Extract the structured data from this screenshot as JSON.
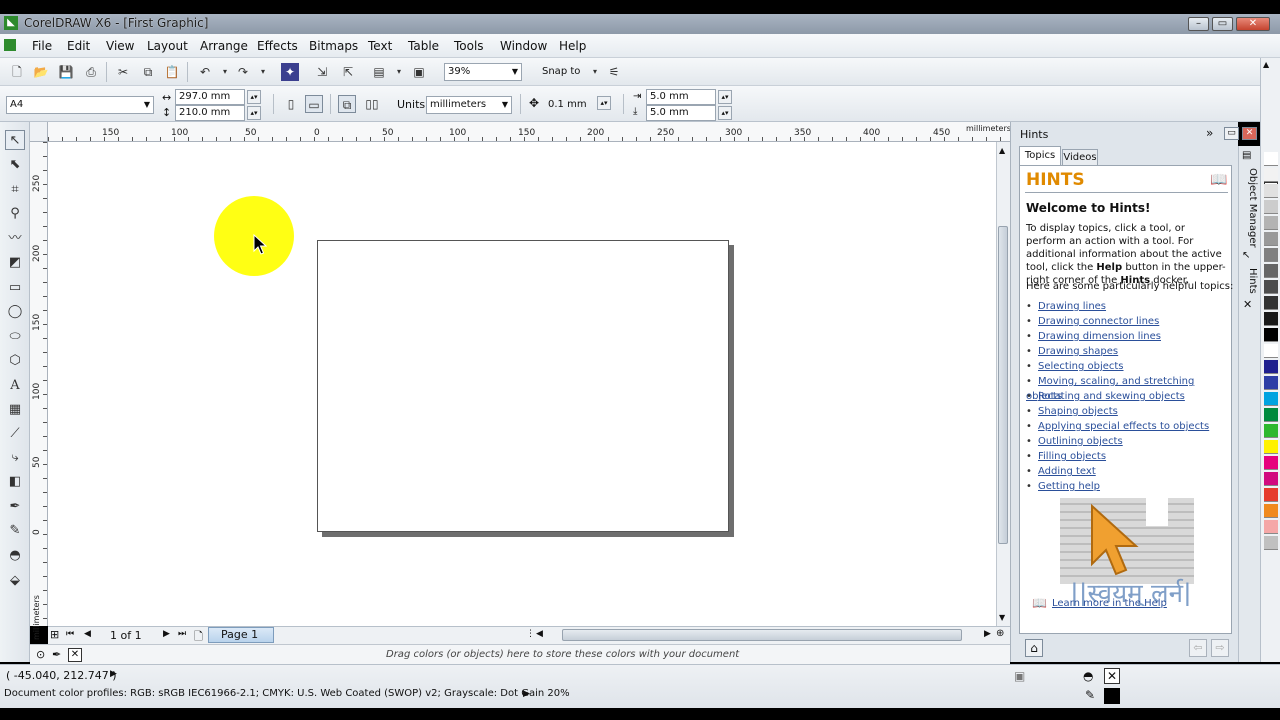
{
  "window": {
    "title": "CorelDRAW X6 - [First Graphic]",
    "controls": {
      "minimize": "–",
      "restore": "▭",
      "close": "✕"
    }
  },
  "menu": [
    "File",
    "Edit",
    "View",
    "Layout",
    "Arrange",
    "Effects",
    "Bitmaps",
    "Text",
    "Table",
    "Tools",
    "Window",
    "Help"
  ],
  "standard_toolbar": {
    "zoom_value": "39%",
    "snap_label": "Snap to"
  },
  "property_bar": {
    "paper_size": "A4",
    "width": "297.0 mm",
    "height": "210.0 mm",
    "units_label": "Units:",
    "units_value": "millimeters",
    "nudge": "0.1 mm",
    "dup_x": "5.0 mm",
    "dup_y": "5.0 mm"
  },
  "rulers": {
    "h_ticks": [
      "150",
      "100",
      "50",
      "0",
      "50",
      "100",
      "150",
      "200",
      "250",
      "300",
      "350",
      "400",
      "450"
    ],
    "h_unit": "millimeters",
    "v_ticks": [
      "250",
      "200",
      "150",
      "100",
      "50",
      "0"
    ],
    "v_unit": "millimeters"
  },
  "page_nav": {
    "counter": "1 of 1",
    "page_tab": "Page 1"
  },
  "document_palette": {
    "hint": "Drag colors (or objects) here to store these colors with your document"
  },
  "status": {
    "coords": "( -45.040, 212.747 )",
    "color_profiles": "Document color profiles: RGB: sRGB IEC61966-2.1; CMYK: U.S. Web Coated (SWOP) v2; Grayscale: Dot Gain 20%"
  },
  "hints_docker": {
    "title": "Hints",
    "tabs": [
      "Topics",
      "Videos"
    ],
    "heading": "HINTS",
    "welcome": "Welcome to Hints!",
    "intro_parts": [
      "To display topics, click a tool, or perform an action with a tool. For additional information about the active tool, click the ",
      "Help",
      " button in the upper-right corner of the ",
      "Hints",
      " docker."
    ],
    "topics_intro": "Here are some particularly helpful topics:",
    "topics": [
      "Drawing lines",
      "Drawing connector lines",
      "Drawing dimension lines",
      "Drawing shapes",
      "Selecting objects",
      "Moving, scaling, and stretching objects",
      "Rotating and skewing objects",
      "Shaping objects",
      "Applying special effects to objects",
      "Outlining objects",
      "Filling objects",
      "Adding text",
      "Getting help"
    ],
    "learn_more": "Learn more in the Help",
    "logo_text": "||स्वयम् लर्न||"
  },
  "side_tabs": [
    "Object Manager",
    "Hints"
  ],
  "palette_colors": [
    "#ffffff",
    "#f2f2f2",
    "#e0e0e0",
    "#cccccc",
    "#b3b3b3",
    "#999999",
    "#808080",
    "#666666",
    "#4d4d4d",
    "#333333",
    "#1a1a1a",
    "#000000",
    "#ffffff",
    "#1f1f8f",
    "#2e3fa6",
    "#00a3e0",
    "#008a3e",
    "#2eb82e",
    "#fff200",
    "#e6007e",
    "#d10a7f",
    "#e63c2e",
    "#f08a1e",
    "#f5a7a7",
    "#c0c0c0"
  ]
}
